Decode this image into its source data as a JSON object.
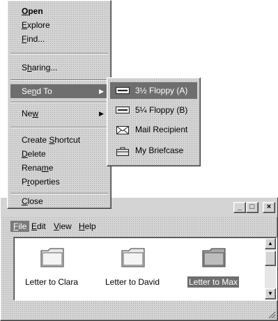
{
  "context_menu": {
    "items": [
      {
        "pre": "",
        "u": "O",
        "post": "pen"
      },
      {
        "pre": "",
        "u": "E",
        "post": "xplore"
      },
      {
        "pre": "",
        "u": "F",
        "post": "ind..."
      },
      {
        "pre": "S",
        "u": "h",
        "post": "aring..."
      },
      {
        "pre": "Se",
        "u": "n",
        "post": "d To"
      },
      {
        "pre": "Ne",
        "u": "w",
        "post": ""
      },
      {
        "pre": "Create ",
        "u": "S",
        "post": "hortcut"
      },
      {
        "pre": "",
        "u": "D",
        "post": "elete"
      },
      {
        "pre": "Rena",
        "u": "m",
        "post": "e"
      },
      {
        "pre": "P",
        "u": "r",
        "post": "operties"
      },
      {
        "pre": "",
        "u": "C",
        "post": "lose"
      }
    ]
  },
  "submenu": {
    "items": [
      {
        "label": "3½ Floppy (A)",
        "icon": "floppy-drive-icon"
      },
      {
        "label": "5¼ Floppy (B)",
        "icon": "floppy-drive-icon"
      },
      {
        "label": "Mail Recipient",
        "icon": "envelope-icon"
      },
      {
        "label": "My Briefcase",
        "icon": "briefcase-icon"
      }
    ]
  },
  "window": {
    "menu": [
      {
        "pre": "",
        "u": "F",
        "post": "ile"
      },
      {
        "pre": "",
        "u": "E",
        "post": "dit"
      },
      {
        "pre": "",
        "u": "V",
        "post": "iew"
      },
      {
        "pre": "",
        "u": "H",
        "post": "elp"
      }
    ],
    "files": [
      {
        "name": "Letter to Clara"
      },
      {
        "name": "Letter to David"
      },
      {
        "name": "Letter to Max"
      }
    ],
    "controls": {
      "minimize": "_",
      "maximize": "□",
      "close": "×"
    }
  }
}
